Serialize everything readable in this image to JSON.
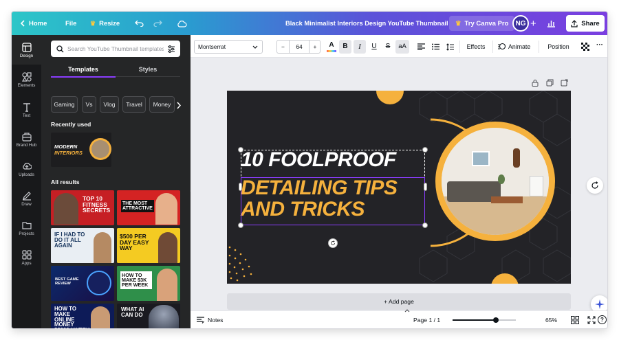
{
  "topbar": {
    "home": "Home",
    "file": "File",
    "resize": "Resize",
    "doc_title": "Black Minimalist Interiors Design YouTube Thumbnail",
    "try_pro": "Try Canva Pro",
    "avatar_initials": "NG",
    "share": "Share",
    "colors": {
      "gradient_start": "#2cc6c8",
      "gradient_end": "#7a3fe0"
    }
  },
  "rail": [
    {
      "label": "Design",
      "icon": "design-icon"
    },
    {
      "label": "Elements",
      "icon": "elements-icon"
    },
    {
      "label": "Text",
      "icon": "text-icon"
    },
    {
      "label": "Brand Hub",
      "icon": "brand-hub-icon"
    },
    {
      "label": "Uploads",
      "icon": "uploads-icon"
    },
    {
      "label": "Draw",
      "icon": "draw-icon"
    },
    {
      "label": "Projects",
      "icon": "projects-icon"
    },
    {
      "label": "Apps",
      "icon": "apps-icon"
    }
  ],
  "panel": {
    "search_placeholder": "Search YouTube Thumbnail templates",
    "tabs": [
      "Templates",
      "Styles"
    ],
    "chips": [
      "Gaming",
      "Vs",
      "Vlog",
      "Travel",
      "Money"
    ],
    "recently_used": "Recently used",
    "recent_thumb": {
      "line1": "MODERN",
      "line2": "INTERIORS"
    },
    "all_results": "All results",
    "templates": [
      {
        "text": "TOP 10 FITNESS SECRETS"
      },
      {
        "text": "THE MOST ATTRACTIVE"
      },
      {
        "text": "IF I HAD TO DO IT ALL AGAIN"
      },
      {
        "text": "$500 PER DAY EASY WAY"
      },
      {
        "text": "BEST GAME REVIEW"
      },
      {
        "text": "HOW TO MAKE $3K PER WEEK"
      },
      {
        "text": "HOW TO MAKE ONLINE MONEY $3000 / WEEK"
      },
      {
        "text": "WHAT AI CAN DO"
      }
    ]
  },
  "toolbar": {
    "font": "Montserrat",
    "size_minus": "−",
    "size": "64",
    "size_plus": "+",
    "color_letter": "A",
    "bold": "B",
    "italic": "I",
    "underline": "U",
    "strike": "S",
    "case": "aA",
    "effects": "Effects",
    "animate": "Animate",
    "position": "Position",
    "more": "···"
  },
  "design": {
    "line1": "10 FOOLPROOF",
    "line2": "DETAILING TIPS",
    "line3": "AND TRICKS",
    "colors": {
      "bg": "#232327",
      "accent": "#f5b13d"
    }
  },
  "add_page": "+ Add page",
  "bottombar": {
    "notes": "Notes",
    "page": "Page 1 / 1",
    "zoom": "65%",
    "zoom_fraction": 0.68,
    "help": "?"
  }
}
